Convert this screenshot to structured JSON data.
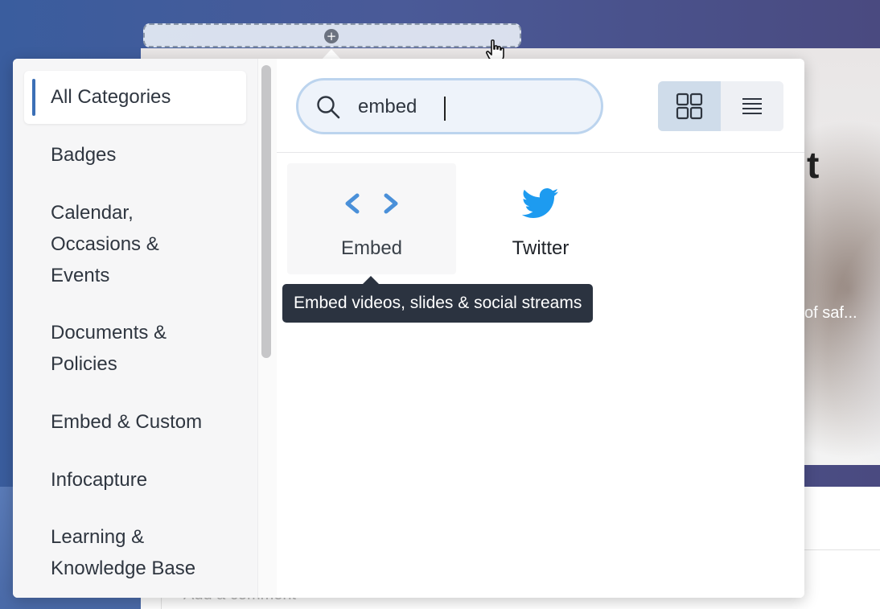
{
  "background": {
    "title_fragment": "t",
    "excerpt_fragment": "of saf...",
    "comment_placeholder": "Add a comment"
  },
  "drop_zone": {
    "plus_icon": "plus-circle-icon",
    "cursor_icon": "hand-pointer-icon"
  },
  "categories": {
    "items": [
      {
        "label": "All Categories",
        "active": true
      },
      {
        "label": "Badges"
      },
      {
        "label": "Calendar,"
      },
      {
        "label": "Occasions &"
      },
      {
        "label": "Events"
      },
      {
        "label": "Documents &"
      },
      {
        "label": "Policies"
      },
      {
        "label": "Embed & Custom"
      },
      {
        "label": "Infocapture"
      },
      {
        "label": "Learning &"
      },
      {
        "label": "Knowledge Base"
      }
    ]
  },
  "search": {
    "value": "embed",
    "icon": "search-icon"
  },
  "view_toggle": {
    "grid_icon": "grid-view-icon",
    "list_icon": "list-view-icon",
    "selected": "grid"
  },
  "results": [
    {
      "label": "Embed",
      "icon": "code-brackets-icon"
    },
    {
      "label": "Twitter",
      "icon": "twitter-bird-icon"
    }
  ],
  "tooltip": {
    "text": "Embed videos, slides & social streams"
  },
  "colors": {
    "accent": "#3b6fb6",
    "embed_icon": "#4a90d9",
    "twitter_blue": "#1d9bf0",
    "tooltip_bg": "#2b3340"
  }
}
